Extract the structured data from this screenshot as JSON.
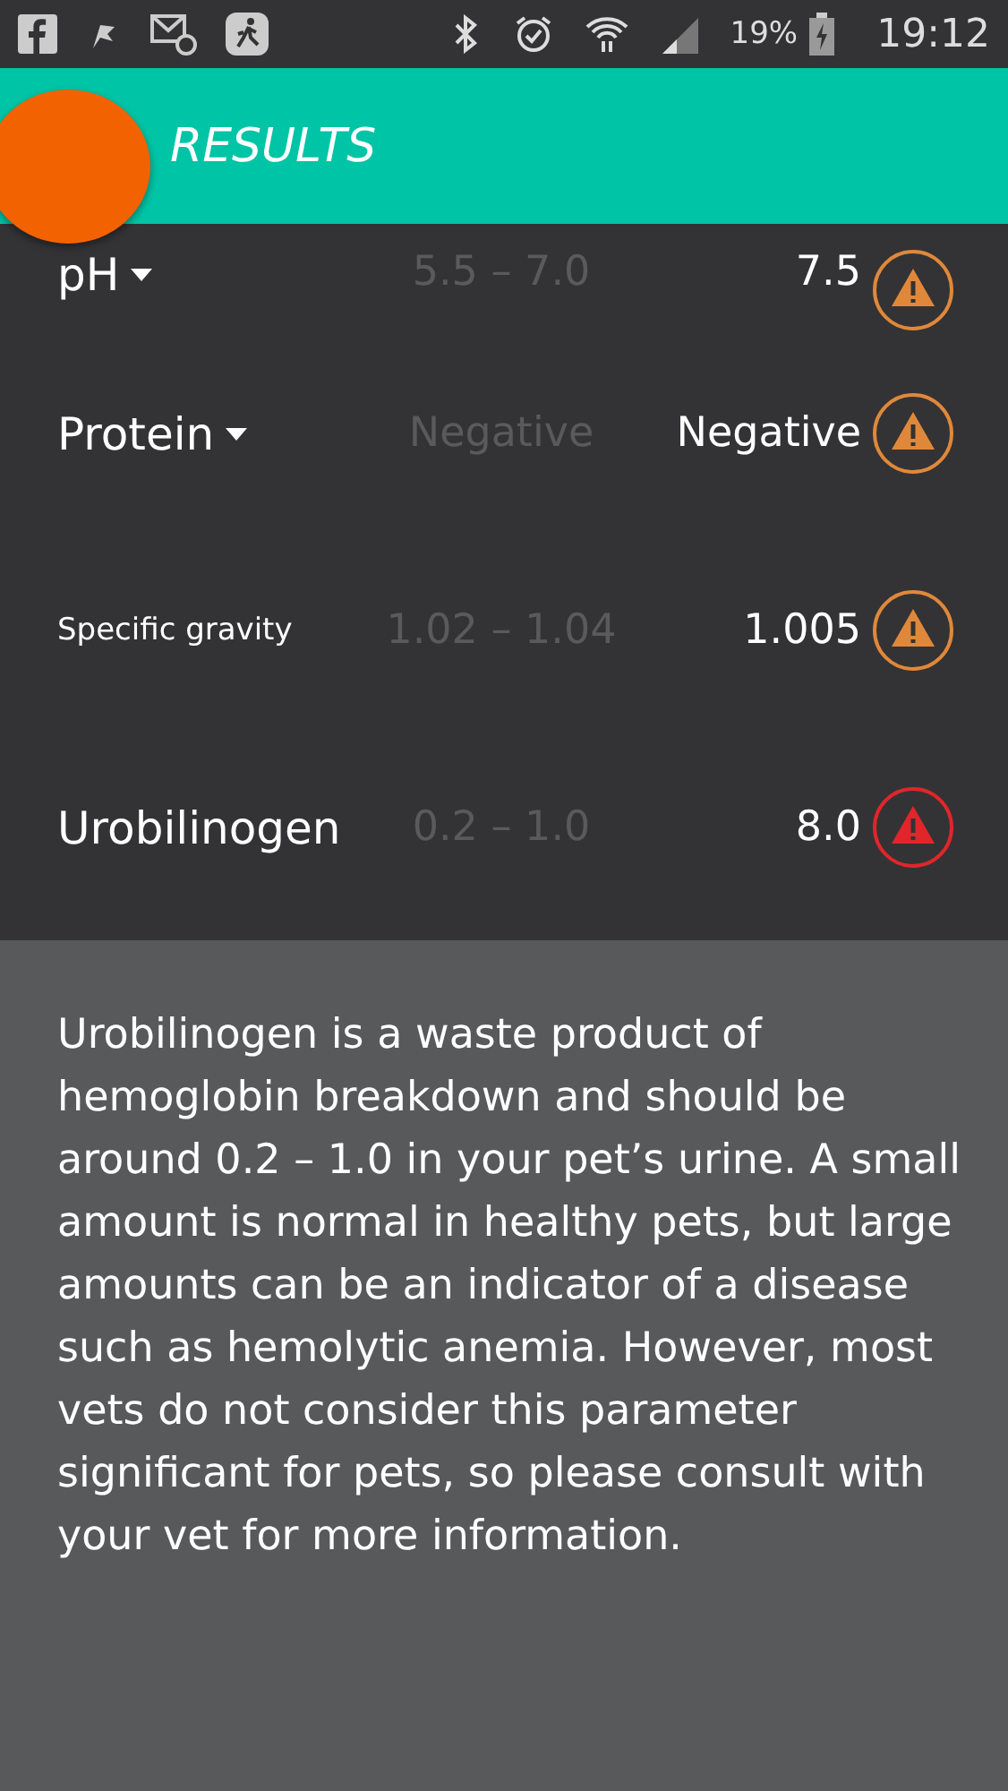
{
  "status_bar": {
    "battery": "19%",
    "time": "19:12"
  },
  "header": {
    "title": "RESULTS"
  },
  "results": [
    {
      "name": "pH",
      "dropdown": true,
      "range": "5.5 – 7.0",
      "value": "7.5",
      "color": "#e0883a"
    },
    {
      "name": "Protein",
      "dropdown": true,
      "range": "Negative",
      "value": "Negative",
      "color": "#e0883a"
    },
    {
      "name": "Specific gravity",
      "dropdown": false,
      "range": "1.02 – 1.04",
      "value": "1.005",
      "color": "#e0883a"
    },
    {
      "name": "Urobilinogen",
      "dropdown": false,
      "range": "0.2 – 1.0",
      "value": "8.0",
      "color": "#e0262a"
    }
  ],
  "description": "Urobilinogen is a waste product of hemoglobin breakdown and should be around 0.2 – 1.0 in your pet’s urine. A small amount is normal in healthy pets, but large amounts can be an indicator of a disease such as hemolytic anemia. However, most vets do not consider this parameter significant for pets, so please consult with your vet for more information."
}
